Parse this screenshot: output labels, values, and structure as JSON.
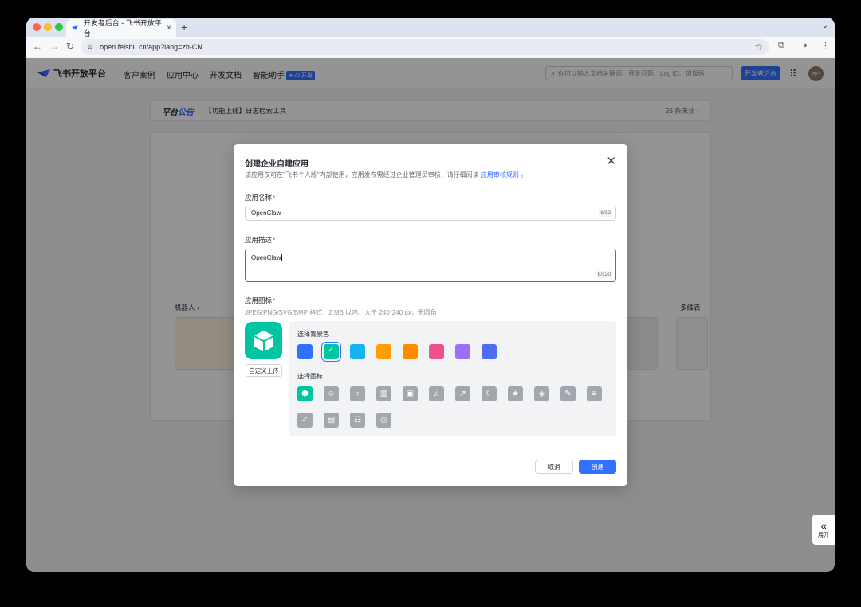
{
  "browser": {
    "tab_title": "开发者后台 - 飞书开放平台",
    "tab_close": "×",
    "new_tab": "+",
    "url": "open.feishu.cn/app?lang=zh-CN"
  },
  "header": {
    "logo_text": "飞书开放平台",
    "nav": [
      "客户案例",
      "应用中心",
      "开发文档",
      "智能助手"
    ],
    "ai_tag": "✦ AI 开发",
    "search_placeholder": "你可以输入文档关键词、开发问题、Log ID、错误码",
    "dev_console_button": "开发者后台",
    "avatar_text": "用户"
  },
  "notice": {
    "brand_prefix": "平台",
    "brand_suffix": "公告",
    "text": "【功能上线】日志检索工具",
    "unread": "26 条未读 ›"
  },
  "background": {
    "robot_label": "机器人 ›",
    "multi_label": "多维表"
  },
  "expand_panel": {
    "label": "展开"
  },
  "modal": {
    "title": "创建企业自建应用",
    "desc_text": "该应用仅可在\"飞书个人版\"内部使用，应用发布需经过企业管理员审核，请仔细阅读 ",
    "desc_link": "应用审核规则",
    "desc_end": " 。",
    "name_label": "应用名称",
    "name_value": "OpenClaw",
    "name_counter": "8/32",
    "desc_label": "应用描述",
    "desc_value": "OpenClaw",
    "desc_counter": "8/120",
    "icon_label": "应用图标",
    "icon_hint": "JPEG/PNG/SVG/BMP 格式，2 MB 以内，大于 240*240 px，无圆角",
    "upload_label": "自定义上传",
    "bg_color_label": "选择背景色",
    "icon_picker_label": "选择图标",
    "colors": [
      "#3370ff",
      "#00c5a3",
      "#14b4f0",
      "#ff9f00",
      "#ff8a00",
      "#f0508c",
      "#9c6ff7",
      "#4e6ef2"
    ],
    "selected_color_index": 1,
    "cancel_label": "取消",
    "create_label": "创建"
  }
}
